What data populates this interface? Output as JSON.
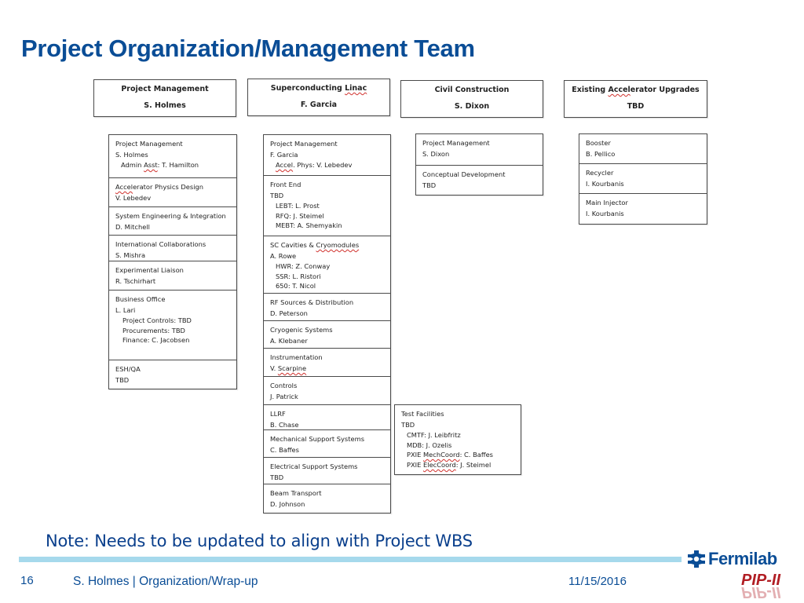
{
  "title": "Project Organization/Management Team",
  "heads": [
    {
      "title": "Project Management",
      "lead": "S. Holmes"
    },
    {
      "title": "Superconducting Linac",
      "lead": "F. Garcia"
    },
    {
      "title": "Civil Construction",
      "lead": "S. Dixon"
    },
    {
      "title": "Existing Accelerator Upgrades",
      "lead": "TBD"
    }
  ],
  "columns": {
    "project_management": [
      {
        "name": "Project Management",
        "lead": "S. Holmes",
        "subs": [
          "Admin Asst: T. Hamilton"
        ]
      },
      {
        "name": "Accelerator Physics Design",
        "lead": "V. Lebedev",
        "subs": []
      },
      {
        "name": "System Engineering & Integration",
        "lead": "D. Mitchell",
        "subs": []
      },
      {
        "name": "International  Collaborations",
        "lead": "S. Mishra",
        "subs": []
      },
      {
        "name": "Experimental Liaison",
        "lead": "R. Tschirhart",
        "subs": []
      },
      {
        "name": "Business Office",
        "lead": "L. Lari",
        "subs": [
          "Project Controls: TBD",
          "Procurements: TBD",
          "Finance: C. Jacobsen"
        ]
      },
      {
        "name": "ESH/QA",
        "lead": "TBD",
        "subs": []
      }
    ],
    "linac": [
      {
        "name": "Project Management",
        "lead": "F. Garcia",
        "subs": [
          "Accel. Phys: V. Lebedev"
        ]
      },
      {
        "name": "Front End",
        "lead": "TBD",
        "subs": [
          "LEBT:  L. Prost",
          "RFQ:   J. Steimel",
          "MEBT:  A. Shemyakin"
        ]
      },
      {
        "name": "SC Cavities & Cryomodules",
        "lead": "A. Rowe",
        "subs": [
          "HWR: Z. Conway",
          "SSR:  L. Ristori",
          "650: T. Nicol"
        ]
      },
      {
        "name": "RF Sources & Distribution",
        "lead": "D. Peterson",
        "subs": []
      },
      {
        "name": "Cryogenic Systems",
        "lead": "A. Klebaner",
        "subs": []
      },
      {
        "name": "Instrumentation",
        "lead": "V. Scarpine",
        "subs": []
      },
      {
        "name": "Controls",
        "lead": "J. Patrick",
        "subs": []
      },
      {
        "name": "LLRF",
        "lead": "B. Chase",
        "subs": []
      },
      {
        "name": "Mechanical Support Systems",
        "lead": "C. Baffes",
        "subs": []
      },
      {
        "name": "Electrical Support Systems",
        "lead": "TBD",
        "subs": []
      },
      {
        "name": "Beam Transport",
        "lead": "D. Johnson",
        "subs": []
      }
    ],
    "civil": [
      {
        "name": "Project Management",
        "lead": "S. Dixon",
        "subs": []
      },
      {
        "name": "Conceptual Development",
        "lead": "TBD",
        "subs": []
      }
    ],
    "test_facilities": [
      {
        "name": "Test Facilities",
        "lead": "TBD",
        "subs": [
          "CMTF: J. Leibfritz",
          "MDB:  J. Ozelis",
          "PXIE MechCoord: C. Baffes",
          "PXIE ElecCoord: J. Steimel"
        ]
      }
    ],
    "upgrades": [
      {
        "name": "Booster",
        "lead": "B. Pellico",
        "subs": []
      },
      {
        "name": "Recycler",
        "lead": "I. Kourbanis",
        "subs": []
      },
      {
        "name": "Main Injector",
        "lead": "I. Kourbanis",
        "subs": []
      }
    ]
  },
  "note": "Note: Needs to be updated to align with Project WBS",
  "footer": {
    "page": "16",
    "text": "S. Holmes | Organization/Wrap-up",
    "date": "11/15/2016",
    "logo": "Fermilab",
    "program": "PIP-II"
  },
  "colors": {
    "title": "#0a4d96",
    "rule": "#a6d9ec",
    "program": "#b11e24"
  }
}
